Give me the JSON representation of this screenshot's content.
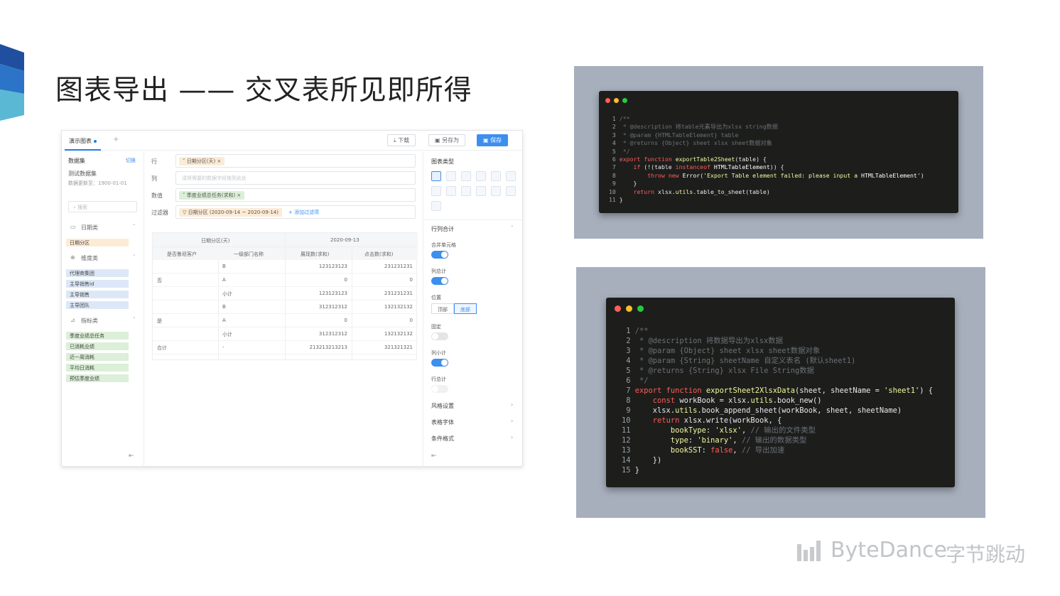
{
  "slide": {
    "title": "图表导出 —— 交叉表所见即所得",
    "accent_colors": [
      "#1f4f9e",
      "#2c74c8",
      "#5ab8d4"
    ]
  },
  "app": {
    "tab_label": "演示图表",
    "tab_add": "+",
    "toolbar": {
      "download": "下载",
      "save_as": "另存为",
      "save": "保存"
    },
    "left": {
      "dataset_label": "数据集",
      "switch_label": "切换",
      "dataset_name": "测试数据集",
      "updated": "数据更新至：1900-01-01",
      "search_placeholder": "搜索",
      "groups": {
        "date": {
          "title": "日期类",
          "items": [
            "日期分区"
          ]
        },
        "dimension": {
          "title": "维度类",
          "items": [
            "代理商集团",
            "主导销售id",
            "主导销售",
            "主导团队"
          ]
        },
        "indicator": {
          "title": "指标类",
          "items": [
            "季度业绩总任务",
            "已消耗业绩",
            "近一周消耗",
            "平均日消耗",
            "预估季度业绩"
          ]
        }
      }
    },
    "config": {
      "row_label": "行",
      "col_label": "列",
      "value_label": "数值",
      "filter_label": "过滤器",
      "row_chip": "日期分区(天)",
      "col_placeholder": "请将需要的数据字段拖到此处",
      "value_chip": "季度业绩总任务(求和)",
      "filter_chip": "日期分区 (2020-09-14 ~ 2020-09-14)",
      "add_filter": "+ 添加过滤项"
    },
    "pivot": {
      "header_top": [
        "日期分区(天)",
        "2020-09-13"
      ],
      "header_cols": [
        "是否鲁班客户",
        "一级部门名称",
        "展现数(求和)",
        "点击数(求和)"
      ],
      "rows": [
        {
          "g": "",
          "d": "B",
          "v1": "123123123",
          "v2": "231231231"
        },
        {
          "g": "否",
          "d": "A",
          "v1": "0",
          "v2": "0"
        },
        {
          "g": "",
          "d": "小计",
          "v1": "123123123",
          "v2": "231231231"
        },
        {
          "g": "",
          "d": "B",
          "v1": "312312312",
          "v2": "132132132"
        },
        {
          "g": "是",
          "d": "A",
          "v1": "0",
          "v2": "0"
        },
        {
          "g": "",
          "d": "小计",
          "v1": "312312312",
          "v2": "132132132"
        },
        {
          "g": "合计",
          "d": "-",
          "v1": "213213213213",
          "v2": "321321321"
        }
      ]
    },
    "right": {
      "chart_type": "图表类型",
      "row_col_total": "行列合计",
      "merge_cells": "合并单元格",
      "col_total": "列总计",
      "position": "位置",
      "pos_top": "顶部",
      "pos_bottom": "底部",
      "fixed": "固定",
      "col_subtotal": "列小计",
      "row_total": "行总计",
      "style_settings": "风格设置",
      "table_font": "表格字体",
      "cond_format": "条件格式",
      "toggles": {
        "merge_cells": true,
        "col_total": true,
        "fixed": false,
        "col_subtotal": true,
        "row_total": false
      }
    }
  },
  "code1": {
    "lines": [
      "/**",
      " * @description 将table元素导出为xlsx string数据",
      " * @param {HTMLTableElement} table",
      " * @returns {Object} sheet xlsx sheet数据对象",
      " */",
      "export function exportTable2Sheet(table) {",
      "    if (!(table instanceof HTMLTableElement)) {",
      "        throw new Error('Export Table element failed: please input a HTMLTableElement')",
      "    }",
      "    return xlsx.utils.table_to_sheet(table)",
      "}"
    ]
  },
  "code2": {
    "lines": [
      "/**",
      " * @description 将数据导出为xlsx数据",
      " * @param {Object} sheet xlsx sheet数据对象",
      " * @param {String} sheetName 自定义表名 (默认sheet1)",
      " * @returns {String} xlsx File String数据",
      " */",
      "export function exportSheet2XlsxData(sheet, sheetName = 'sheet1') {",
      "    const workBook = xlsx.utils.book_new()",
      "    xlsx.utils.book_append_sheet(workBook, sheet, sheetName)",
      "    return xlsx.write(workBook, {",
      "        bookType: 'xlsx', // 输出的文件类型",
      "        type: 'binary', // 输出的数据类型",
      "        bookSST: false, // 导出加速",
      "    })",
      "}"
    ]
  },
  "brand": {
    "word": "ByteDance",
    "cn": "字节跳动"
  }
}
